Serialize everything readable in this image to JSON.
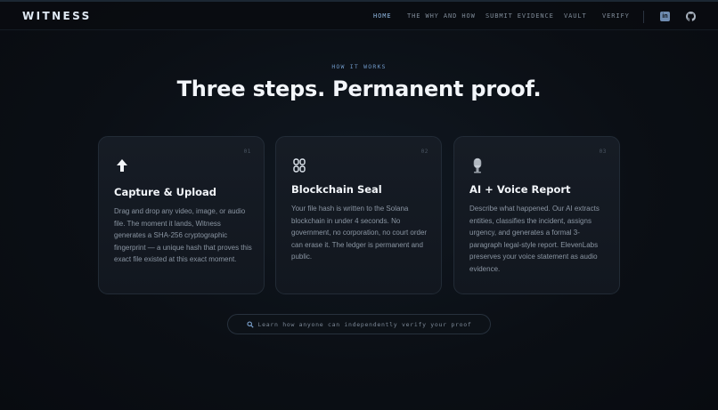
{
  "brand": {
    "name": "WITNESS"
  },
  "nav": {
    "links": [
      {
        "label": "HOME",
        "active": true
      },
      {
        "label": "THE WHY AND HOW",
        "active": false
      },
      {
        "label": "SUBMIT EVIDENCE",
        "active": false
      },
      {
        "label": "VAULT",
        "active": false
      },
      {
        "label": "VERIFY",
        "active": false
      }
    ],
    "social": [
      {
        "icon": "linkedin-icon"
      },
      {
        "icon": "github-icon"
      }
    ]
  },
  "section": {
    "eyebrow": "HOW IT WORKS",
    "headline": "Three steps. Permanent proof."
  },
  "steps": [
    {
      "number": "01",
      "icon": "upload-arrow-icon",
      "title": "Capture & Upload",
      "description": "Drag and drop any video, image, or audio file. The moment it lands, Witness generates a SHA-256 cryptographic fingerprint — a unique hash that proves this exact file existed at this exact moment."
    },
    {
      "number": "02",
      "icon": "chain-link-icon",
      "title": "Blockchain Seal",
      "description": "Your file hash is written to the Solana blockchain in under 4 seconds. No government, no corporation, no court order can erase it. The ledger is permanent and public."
    },
    {
      "number": "03",
      "icon": "microphone-icon",
      "title": "AI + Voice Report",
      "description": "Describe what happened. Our AI extracts entities, classifies the incident, assigns urgency, and generates a formal 3-paragraph legal-style report. ElevenLabs preserves your voice statement as audio evidence."
    }
  ],
  "cta": {
    "icon": "magnifier-icon",
    "label": "Learn how anyone can independently verify your proof"
  },
  "colors": {
    "background": "#0b0f15",
    "accent": "#8fb7e0",
    "card": "#161c25"
  }
}
